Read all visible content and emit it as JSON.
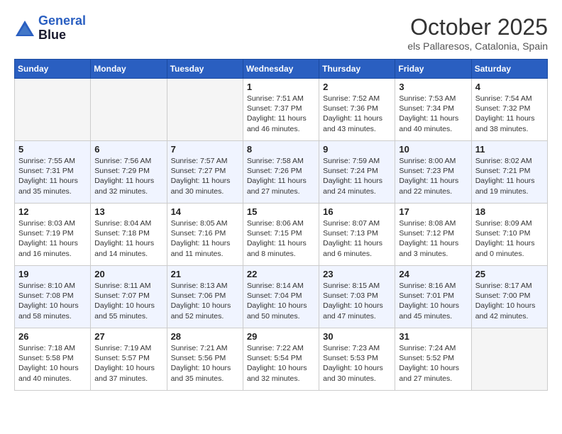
{
  "header": {
    "logo_line1": "General",
    "logo_line2": "Blue",
    "month": "October 2025",
    "location": "els Pallaresos, Catalonia, Spain"
  },
  "weekdays": [
    "Sunday",
    "Monday",
    "Tuesday",
    "Wednesday",
    "Thursday",
    "Friday",
    "Saturday"
  ],
  "weeks": [
    [
      {
        "day": "",
        "info": ""
      },
      {
        "day": "",
        "info": ""
      },
      {
        "day": "",
        "info": ""
      },
      {
        "day": "1",
        "info": "Sunrise: 7:51 AM\nSunset: 7:37 PM\nDaylight: 11 hours\nand 46 minutes."
      },
      {
        "day": "2",
        "info": "Sunrise: 7:52 AM\nSunset: 7:36 PM\nDaylight: 11 hours\nand 43 minutes."
      },
      {
        "day": "3",
        "info": "Sunrise: 7:53 AM\nSunset: 7:34 PM\nDaylight: 11 hours\nand 40 minutes."
      },
      {
        "day": "4",
        "info": "Sunrise: 7:54 AM\nSunset: 7:32 PM\nDaylight: 11 hours\nand 38 minutes."
      }
    ],
    [
      {
        "day": "5",
        "info": "Sunrise: 7:55 AM\nSunset: 7:31 PM\nDaylight: 11 hours\nand 35 minutes."
      },
      {
        "day": "6",
        "info": "Sunrise: 7:56 AM\nSunset: 7:29 PM\nDaylight: 11 hours\nand 32 minutes."
      },
      {
        "day": "7",
        "info": "Sunrise: 7:57 AM\nSunset: 7:27 PM\nDaylight: 11 hours\nand 30 minutes."
      },
      {
        "day": "8",
        "info": "Sunrise: 7:58 AM\nSunset: 7:26 PM\nDaylight: 11 hours\nand 27 minutes."
      },
      {
        "day": "9",
        "info": "Sunrise: 7:59 AM\nSunset: 7:24 PM\nDaylight: 11 hours\nand 24 minutes."
      },
      {
        "day": "10",
        "info": "Sunrise: 8:00 AM\nSunset: 7:23 PM\nDaylight: 11 hours\nand 22 minutes."
      },
      {
        "day": "11",
        "info": "Sunrise: 8:02 AM\nSunset: 7:21 PM\nDaylight: 11 hours\nand 19 minutes."
      }
    ],
    [
      {
        "day": "12",
        "info": "Sunrise: 8:03 AM\nSunset: 7:19 PM\nDaylight: 11 hours\nand 16 minutes."
      },
      {
        "day": "13",
        "info": "Sunrise: 8:04 AM\nSunset: 7:18 PM\nDaylight: 11 hours\nand 14 minutes."
      },
      {
        "day": "14",
        "info": "Sunrise: 8:05 AM\nSunset: 7:16 PM\nDaylight: 11 hours\nand 11 minutes."
      },
      {
        "day": "15",
        "info": "Sunrise: 8:06 AM\nSunset: 7:15 PM\nDaylight: 11 hours\nand 8 minutes."
      },
      {
        "day": "16",
        "info": "Sunrise: 8:07 AM\nSunset: 7:13 PM\nDaylight: 11 hours\nand 6 minutes."
      },
      {
        "day": "17",
        "info": "Sunrise: 8:08 AM\nSunset: 7:12 PM\nDaylight: 11 hours\nand 3 minutes."
      },
      {
        "day": "18",
        "info": "Sunrise: 8:09 AM\nSunset: 7:10 PM\nDaylight: 11 hours\nand 0 minutes."
      }
    ],
    [
      {
        "day": "19",
        "info": "Sunrise: 8:10 AM\nSunset: 7:08 PM\nDaylight: 10 hours\nand 58 minutes."
      },
      {
        "day": "20",
        "info": "Sunrise: 8:11 AM\nSunset: 7:07 PM\nDaylight: 10 hours\nand 55 minutes."
      },
      {
        "day": "21",
        "info": "Sunrise: 8:13 AM\nSunset: 7:06 PM\nDaylight: 10 hours\nand 52 minutes."
      },
      {
        "day": "22",
        "info": "Sunrise: 8:14 AM\nSunset: 7:04 PM\nDaylight: 10 hours\nand 50 minutes."
      },
      {
        "day": "23",
        "info": "Sunrise: 8:15 AM\nSunset: 7:03 PM\nDaylight: 10 hours\nand 47 minutes."
      },
      {
        "day": "24",
        "info": "Sunrise: 8:16 AM\nSunset: 7:01 PM\nDaylight: 10 hours\nand 45 minutes."
      },
      {
        "day": "25",
        "info": "Sunrise: 8:17 AM\nSunset: 7:00 PM\nDaylight: 10 hours\nand 42 minutes."
      }
    ],
    [
      {
        "day": "26",
        "info": "Sunrise: 7:18 AM\nSunset: 5:58 PM\nDaylight: 10 hours\nand 40 minutes."
      },
      {
        "day": "27",
        "info": "Sunrise: 7:19 AM\nSunset: 5:57 PM\nDaylight: 10 hours\nand 37 minutes."
      },
      {
        "day": "28",
        "info": "Sunrise: 7:21 AM\nSunset: 5:56 PM\nDaylight: 10 hours\nand 35 minutes."
      },
      {
        "day": "29",
        "info": "Sunrise: 7:22 AM\nSunset: 5:54 PM\nDaylight: 10 hours\nand 32 minutes."
      },
      {
        "day": "30",
        "info": "Sunrise: 7:23 AM\nSunset: 5:53 PM\nDaylight: 10 hours\nand 30 minutes."
      },
      {
        "day": "31",
        "info": "Sunrise: 7:24 AM\nSunset: 5:52 PM\nDaylight: 10 hours\nand 27 minutes."
      },
      {
        "day": "",
        "info": ""
      }
    ]
  ]
}
